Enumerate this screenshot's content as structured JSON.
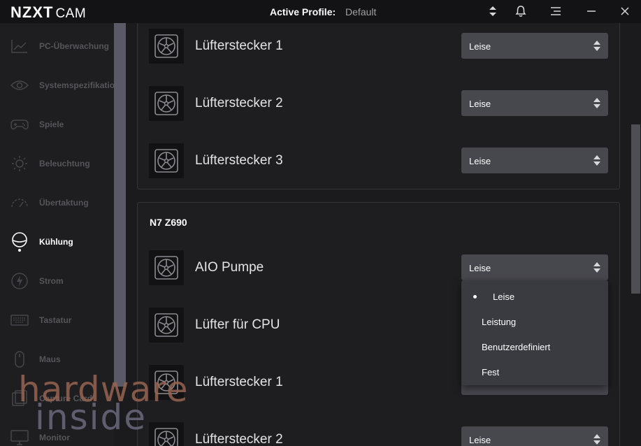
{
  "app": {
    "brand": "NZXT",
    "name": "CAM"
  },
  "header": {
    "profile_label": "Active Profile:",
    "profile_value": "Default"
  },
  "sidebar": {
    "items": [
      {
        "label": "PC-Überwachung",
        "icon": "chart-line-icon"
      },
      {
        "label": "Systemspezifikationen",
        "icon": "eye-icon"
      },
      {
        "label": "Spiele",
        "icon": "gamepad-icon"
      },
      {
        "label": "Beleuchtung",
        "icon": "sun-icon"
      },
      {
        "label": "Übertaktung",
        "icon": "gauge-icon"
      },
      {
        "label": "Kühlung",
        "icon": "cooling-icon",
        "active": true
      },
      {
        "label": "Strom",
        "icon": "bolt-icon"
      },
      {
        "label": "Tastatur",
        "icon": "keyboard-icon"
      },
      {
        "label": "Maus",
        "icon": "mouse-icon"
      },
      {
        "label": "Capture Card",
        "icon": "capture-card-icon"
      },
      {
        "label": "Monitor",
        "icon": "monitor-icon"
      }
    ]
  },
  "main": {
    "card1": {
      "rows": [
        {
          "label": "Lüfterstecker 1",
          "mode": "Leise"
        },
        {
          "label": "Lüfterstecker 2",
          "mode": "Leise"
        },
        {
          "label": "Lüfterstecker 3",
          "mode": "Leise"
        }
      ]
    },
    "card2": {
      "title": "N7 Z690",
      "rows": [
        {
          "label": "AIO Pumpe",
          "mode": "Leise"
        },
        {
          "label": "Lüfter für CPU",
          "mode": ""
        },
        {
          "label": "Lüfterstecker 1",
          "mode": ""
        },
        {
          "label": "Lüfterstecker 2",
          "mode": "Leise"
        }
      ]
    }
  },
  "dropdown": {
    "options": [
      "Leise",
      "Leistung",
      "Benutzerdefiniert",
      "Fest"
    ],
    "selected": "Leise"
  },
  "watermark": {
    "line1": "hardware",
    "line2": "inside"
  },
  "colors": {
    "background": "#1b1b1e",
    "select": "#47474e",
    "dropdown": "#3a3a41"
  }
}
